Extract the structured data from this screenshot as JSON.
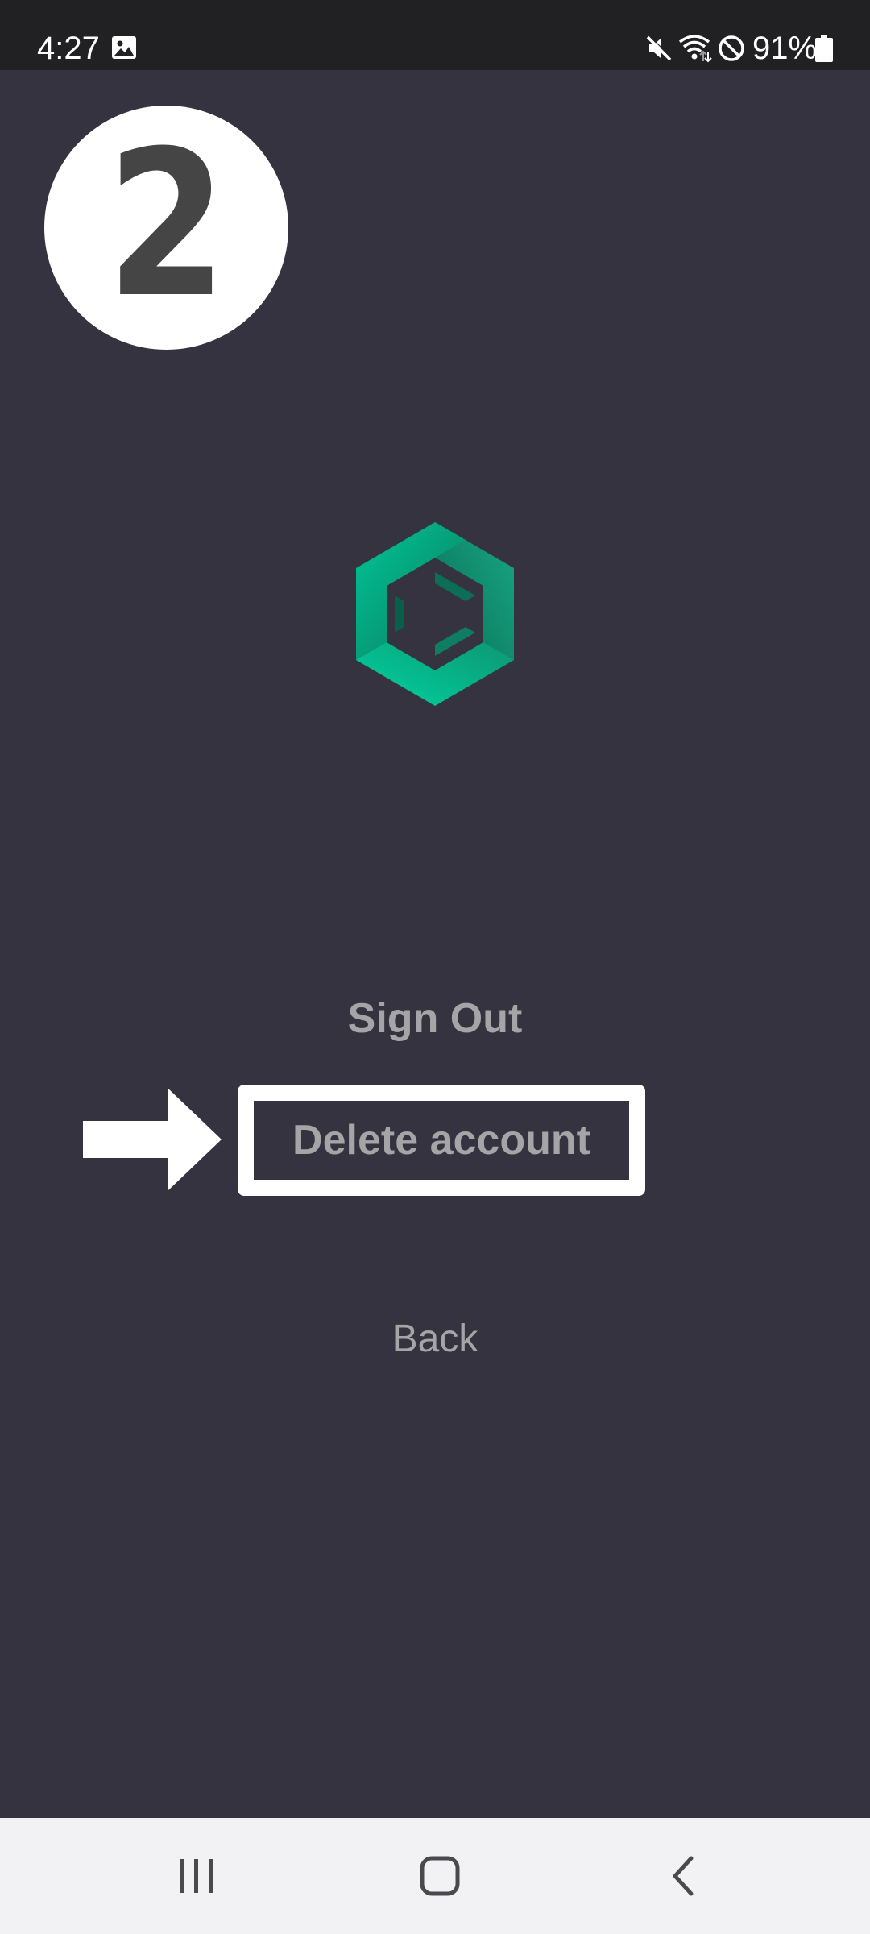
{
  "status_bar": {
    "time": "4:27",
    "battery_percent": "91%",
    "icons": [
      "gallery-icon",
      "mute-icon",
      "wifi-icon",
      "do-not-disturb-icon",
      "battery-icon"
    ]
  },
  "step_badge": {
    "number": "2"
  },
  "logo": {
    "icon": "hexagon-logo-icon",
    "colors": [
      "#00b38a",
      "#0e7f63",
      "#1a9c79"
    ]
  },
  "menu": {
    "sign_out_label": "Sign Out",
    "delete_account_label": "Delete account",
    "back_label": "Back"
  },
  "annotation": {
    "arrow_icon": "arrow-right-icon",
    "highlight_color": "#ffffff"
  },
  "nav_bar": {
    "icons": [
      "recents-icon",
      "home-icon",
      "back-icon"
    ]
  },
  "colors": {
    "background": "#34333f",
    "status_bar": "#212124",
    "menu_text": "#a5a5a7",
    "nav_bar": "#f2f2f4"
  }
}
